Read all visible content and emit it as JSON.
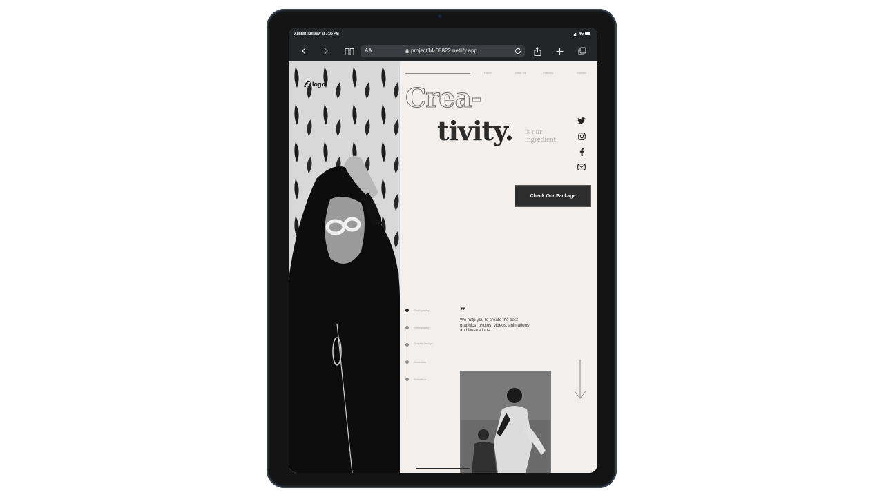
{
  "status_bar": {
    "time": "August Tuesday at 3:05 PM",
    "network": "4G"
  },
  "browser": {
    "reader_label": "AA",
    "url": "project14-08822.netlify.app"
  },
  "site": {
    "logo_text": "logo",
    "nav": [
      "Home",
      "About Us",
      "Portfolio",
      "Contact"
    ],
    "hero": {
      "word_part1": "Crea-",
      "word_part2": "tivity.",
      "tagline": "is our ingredient",
      "cta_label": "Check Our Package"
    },
    "social_icons": [
      "twitter-icon",
      "instagram-icon",
      "facebook-icon",
      "mail-icon"
    ],
    "services": [
      "Photography",
      "Videography",
      "Graphic Design",
      "Illustration",
      "Animation"
    ],
    "quote": "We help you to create the best graphics, photos, videos, animations and illustrations"
  },
  "colors": {
    "background": "#f2efec",
    "dark": "#2c2c2c",
    "device_frame": "#141414",
    "toolbar": "#232629"
  }
}
